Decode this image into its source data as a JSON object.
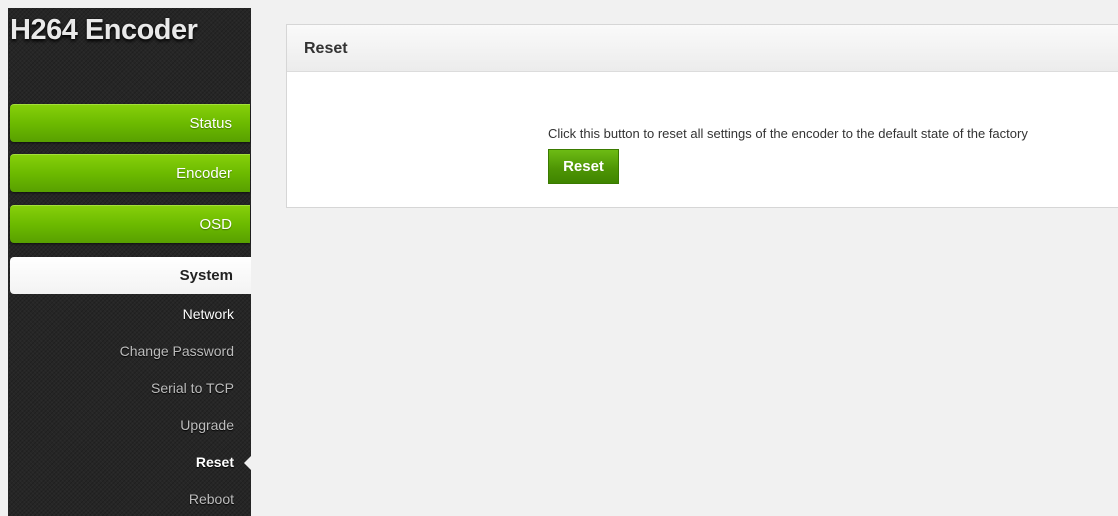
{
  "sidebar": {
    "logo": "H264 Encoder",
    "nav": {
      "status": "Status",
      "encoder": "Encoder",
      "osd": "OSD"
    },
    "section_title": "System",
    "items": {
      "network": "Network",
      "change_password": "Change Password",
      "serial_to_tcp": "Serial to TCP",
      "upgrade": "Upgrade",
      "reset": "Reset",
      "reboot": "Reboot"
    },
    "active_item": "Reset"
  },
  "panel": {
    "title": "Reset",
    "description": "Click this button to reset all settings of the encoder to the default state of the factory",
    "button_label": "Reset"
  },
  "colors": {
    "accent_green": "#6cba00",
    "sidebar_bg": "#262626",
    "page_bg": "#f1f1f1"
  }
}
